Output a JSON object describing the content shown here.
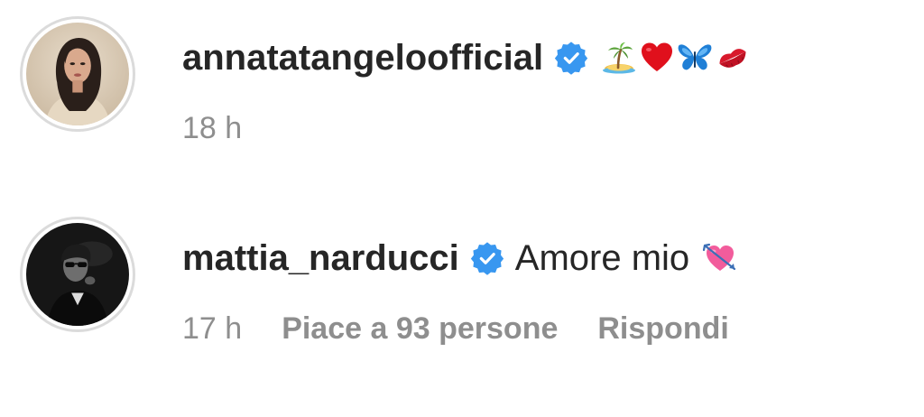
{
  "comments": [
    {
      "username": "annatatangeloofficial",
      "verified": true,
      "emojis": [
        "desert-island-emoji",
        "red-heart-emoji",
        "blue-butterfly-emoji",
        "kiss-mark-emoji"
      ],
      "time": "18 h"
    },
    {
      "username": "mattia_narducci",
      "verified": true,
      "text": "Amore mio",
      "emojis": [
        "heart-with-arrow-emoji"
      ],
      "time": "17 h",
      "likes": "Piace a 93 persone",
      "reply": "Rispondi"
    }
  ],
  "colors": {
    "verified_badge": "#3897f0",
    "secondary_text": "#8e8e8e",
    "primary_text": "#262626",
    "avatar_ring": "#dbdbdb"
  }
}
